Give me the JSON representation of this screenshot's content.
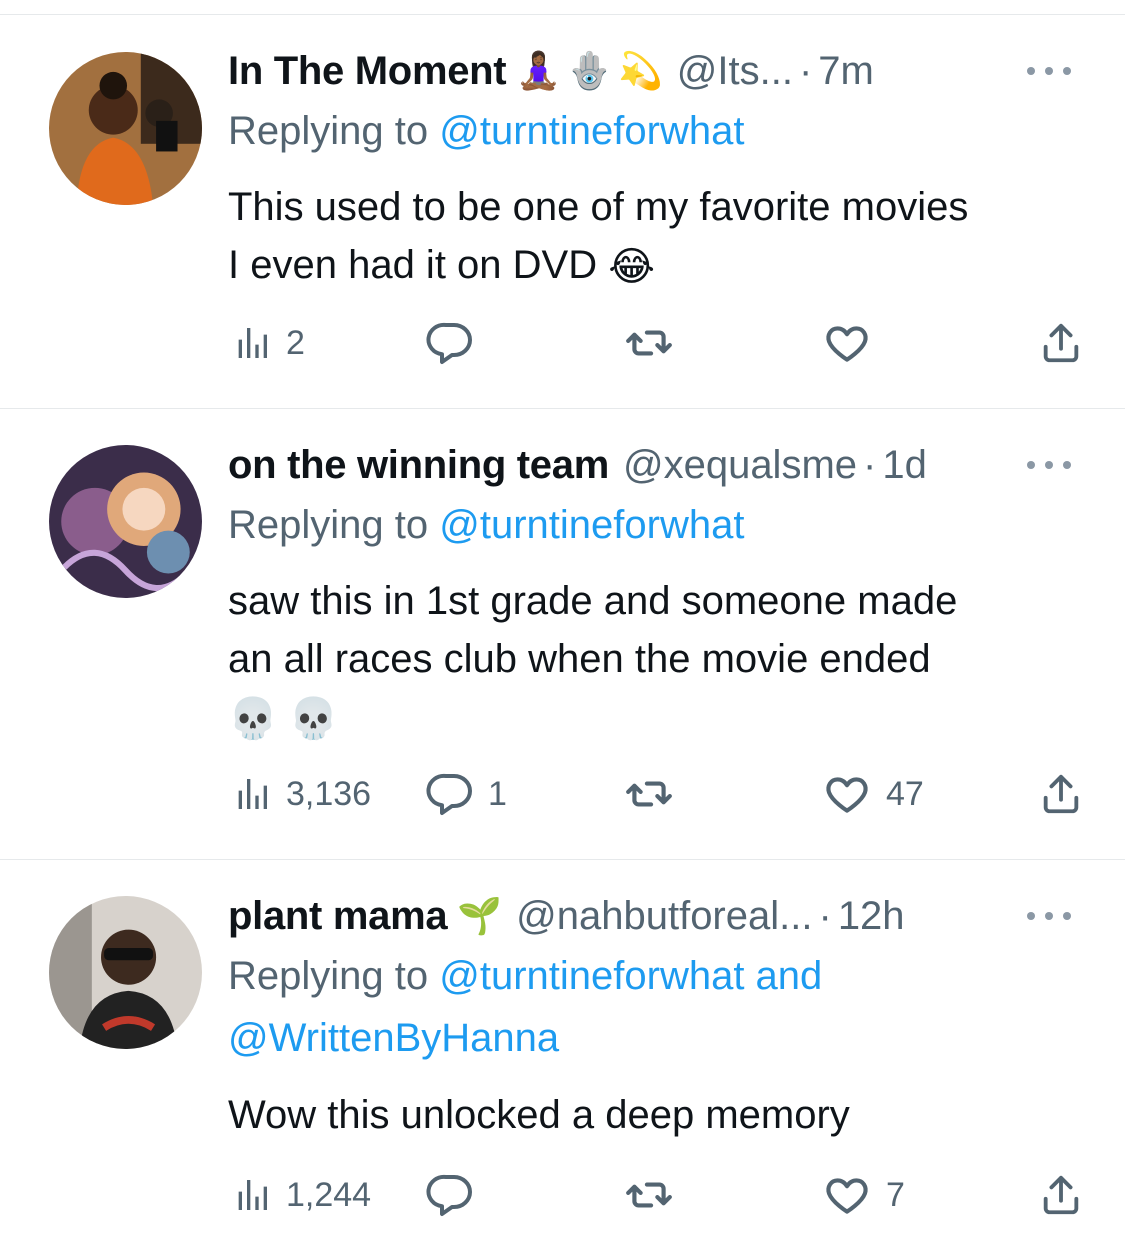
{
  "tweets": [
    {
      "name": "In The Moment",
      "badges": [
        "🧘🏾‍♀️",
        "🪬",
        "💫"
      ],
      "handle": "@Its...",
      "sep": "·",
      "time": "7m",
      "replying_prefix": "Replying to ",
      "replying_to": "@turntineforwhat",
      "replying_line2": "",
      "body_line1": "This used to be one of my favorite movies",
      "body_line2": "I even had it on DVD ",
      "body_emoji": "😂",
      "views": "2",
      "replies": "",
      "retweets": "",
      "likes": ""
    },
    {
      "name": "on the winning team",
      "badges": [],
      "handle": "@xequalsme",
      "sep": "·",
      "time": "1d",
      "replying_prefix": "Replying to ",
      "replying_to": "@turntineforwhat",
      "replying_line2": "",
      "body_line1": "saw this in 1st grade and someone made",
      "body_line2": "an all races club when the movie ended",
      "body_emoji": "💀 💀",
      "views": "3,136",
      "replies": "1",
      "retweets": "",
      "likes": "47"
    },
    {
      "name": "plant mama",
      "badges": [
        "🌱"
      ],
      "handle": "@nahbutforeal...",
      "sep": "·",
      "time": "12h",
      "replying_prefix": "Replying to ",
      "replying_to": "@turntineforwhat and",
      "replying_line2": "@WrittenByHanna",
      "body_line1": "Wow this unlocked a deep memory",
      "body_line2": "",
      "body_emoji": "",
      "views": "1,244",
      "replies": "",
      "retweets": "",
      "likes": "7"
    }
  ],
  "icons": {
    "views": "bar-chart-icon",
    "reply": "speech-bubble-icon",
    "retweet": "retweet-icon",
    "like": "heart-icon",
    "share": "share-icon",
    "more": "more-options-icon"
  },
  "colors": {
    "text": "#0f1419",
    "secondary": "#536471",
    "link": "#1d9bf0",
    "divider": "#e6e9eb"
  }
}
